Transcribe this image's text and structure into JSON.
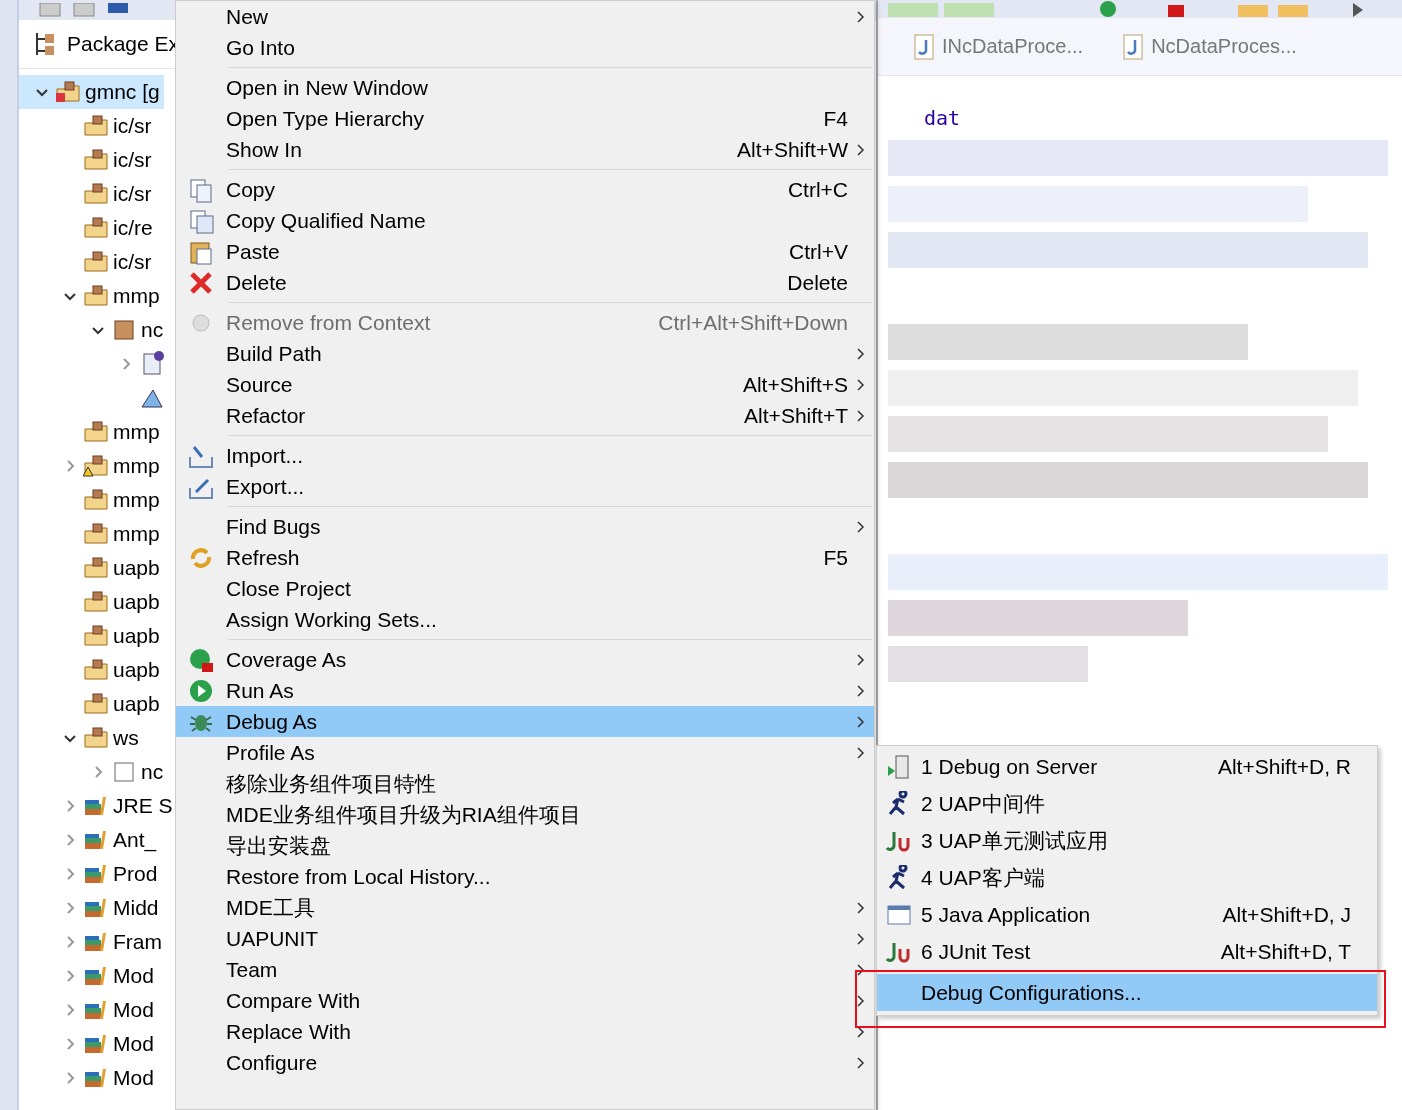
{
  "explorer": {
    "title": "Package Ex",
    "tree": [
      {
        "label": "gmnc [g",
        "kind": "project",
        "expanded": true,
        "selected": true,
        "children": [
          {
            "label": "ic/sr",
            "kind": "package-folder",
            "selected": false
          },
          {
            "label": "ic/sr",
            "kind": "package-folder",
            "selected": false
          },
          {
            "label": "ic/sr",
            "kind": "package-folder",
            "selected": false
          },
          {
            "label": "ic/re",
            "kind": "package-folder",
            "selected": false
          },
          {
            "label": "ic/sr",
            "kind": "package-folder",
            "selected": false
          },
          {
            "label": "mmp",
            "kind": "package-folder",
            "expanded": true,
            "selected": false,
            "children": [
              {
                "label": "nc",
                "kind": "package",
                "expanded": true,
                "selected": false,
                "children": [
                  {
                    "kind": "interface-file",
                    "expanded": false,
                    "selected": false
                  },
                  {
                    "kind": "diagram-file",
                    "selected": false
                  }
                ]
              }
            ]
          },
          {
            "label": "mmp",
            "kind": "package-folder",
            "selected": false
          },
          {
            "label": "mmp",
            "kind": "warning-folder",
            "expanded": false,
            "selected": false
          },
          {
            "label": "mmp",
            "kind": "package-folder",
            "selected": false
          },
          {
            "label": "mmp",
            "kind": "package-folder",
            "selected": false
          },
          {
            "label": "uapb",
            "kind": "package-folder",
            "selected": false
          },
          {
            "label": "uapb",
            "kind": "package-folder",
            "selected": false
          },
          {
            "label": "uapb",
            "kind": "package-folder",
            "selected": false
          },
          {
            "label": "uapb",
            "kind": "package-folder",
            "selected": false
          },
          {
            "label": "uapb",
            "kind": "package-folder",
            "selected": false
          },
          {
            "label": "ws",
            "kind": "package-folder",
            "expanded": true,
            "selected": false,
            "children": [
              {
                "label": "nc",
                "kind": "empty-package",
                "expanded": false,
                "selected": false
              }
            ]
          },
          {
            "label": "JRE S",
            "kind": "library",
            "expanded": false,
            "selected": false
          },
          {
            "label": "Ant_",
            "kind": "library",
            "expanded": false,
            "selected": false
          },
          {
            "label": "Prod",
            "kind": "library",
            "expanded": false,
            "selected": false
          },
          {
            "label": "Midd",
            "kind": "library",
            "expanded": false,
            "selected": false
          },
          {
            "label": "Fram",
            "kind": "library",
            "expanded": false,
            "selected": false
          },
          {
            "label": "Mod",
            "kind": "library",
            "expanded": false,
            "selected": false
          },
          {
            "label": "Mod",
            "kind": "library",
            "expanded": false,
            "selected": false
          },
          {
            "label": "Mod",
            "kind": "library",
            "expanded": false,
            "selected": false
          },
          {
            "label": "Mod",
            "kind": "library",
            "expanded": false,
            "selected": false
          }
        ]
      }
    ]
  },
  "editor": {
    "tabs": [
      {
        "label": "INcDataProce...",
        "selected": false
      },
      {
        "label": "NcDataProces...",
        "selected": false
      }
    ],
    "code_fragment": "dat"
  },
  "context_menu": [
    {
      "kind": "plain",
      "label": "New",
      "has_submenu": true,
      "disabled": false,
      "selected": false
    },
    {
      "kind": "plain",
      "label": "Go Into",
      "has_submenu": false,
      "disabled": false,
      "selected": false
    },
    {
      "kind": "separator"
    },
    {
      "kind": "plain",
      "label": "Open in New Window",
      "has_submenu": false,
      "disabled": false,
      "selected": false
    },
    {
      "kind": "plain",
      "label": "Open Type Hierarchy",
      "shortcut": "F4",
      "has_submenu": false,
      "disabled": false,
      "selected": false
    },
    {
      "kind": "plain",
      "label": "Show In",
      "shortcut": "Alt+Shift+W",
      "has_submenu": true,
      "disabled": false,
      "selected": false
    },
    {
      "kind": "separator"
    },
    {
      "kind": "copy",
      "label": "Copy",
      "shortcut": "Ctrl+C",
      "has_submenu": false,
      "disabled": false,
      "selected": false
    },
    {
      "kind": "copy-qualified",
      "label": "Copy Qualified Name",
      "has_submenu": false,
      "disabled": false,
      "selected": false
    },
    {
      "kind": "paste",
      "label": "Paste",
      "shortcut": "Ctrl+V",
      "has_submenu": false,
      "disabled": false,
      "selected": false
    },
    {
      "kind": "delete",
      "label": "Delete",
      "shortcut": "Delete",
      "has_submenu": false,
      "disabled": false,
      "selected": false
    },
    {
      "kind": "separator"
    },
    {
      "kind": "remove",
      "label": "Remove from Context",
      "shortcut": "Ctrl+Alt+Shift+Down",
      "has_submenu": false,
      "disabled": true,
      "selected": false
    },
    {
      "kind": "plain",
      "label": "Build Path",
      "has_submenu": true,
      "disabled": false,
      "selected": false
    },
    {
      "kind": "plain",
      "label": "Source",
      "shortcut": "Alt+Shift+S",
      "has_submenu": true,
      "disabled": false,
      "selected": false
    },
    {
      "kind": "plain",
      "label": "Refactor",
      "shortcut": "Alt+Shift+T",
      "has_submenu": true,
      "disabled": false,
      "selected": false
    },
    {
      "kind": "separator"
    },
    {
      "kind": "import",
      "label": "Import...",
      "has_submenu": false,
      "disabled": false,
      "selected": false
    },
    {
      "kind": "export",
      "label": "Export...",
      "has_submenu": false,
      "disabled": false,
      "selected": false
    },
    {
      "kind": "separator"
    },
    {
      "kind": "plain",
      "label": "Find Bugs",
      "has_submenu": true,
      "disabled": false,
      "selected": false
    },
    {
      "kind": "refresh",
      "label": "Refresh",
      "shortcut": "F5",
      "has_submenu": false,
      "disabled": false,
      "selected": false
    },
    {
      "kind": "plain",
      "label": "Close Project",
      "has_submenu": false,
      "disabled": false,
      "selected": false
    },
    {
      "kind": "plain",
      "label": "Assign Working Sets...",
      "has_submenu": false,
      "disabled": false,
      "selected": false
    },
    {
      "kind": "separator"
    },
    {
      "kind": "coverage",
      "label": "Coverage As",
      "has_submenu": true,
      "disabled": false,
      "selected": false
    },
    {
      "kind": "run",
      "label": "Run As",
      "has_submenu": true,
      "disabled": false,
      "selected": false
    },
    {
      "kind": "debug",
      "label": "Debug As",
      "has_submenu": true,
      "disabled": false,
      "selected": true
    },
    {
      "kind": "plain",
      "label": "Profile As",
      "has_submenu": true,
      "disabled": false,
      "selected": false
    },
    {
      "kind": "plain",
      "label": "移除业务组件项目特性",
      "has_submenu": false,
      "disabled": false,
      "selected": false
    },
    {
      "kind": "plain",
      "label": "MDE业务组件项目升级为RIA组件项目",
      "has_submenu": false,
      "disabled": false,
      "selected": false
    },
    {
      "kind": "plain",
      "label": "导出安装盘",
      "has_submenu": false,
      "disabled": false,
      "selected": false
    },
    {
      "kind": "plain",
      "label": "Restore from Local History...",
      "has_submenu": false,
      "disabled": false,
      "selected": false
    },
    {
      "kind": "plain",
      "label": "MDE工具",
      "has_submenu": true,
      "disabled": false,
      "selected": false
    },
    {
      "kind": "plain",
      "label": "UAPUNIT",
      "has_submenu": true,
      "disabled": false,
      "selected": false
    },
    {
      "kind": "plain",
      "label": "Team",
      "has_submenu": true,
      "disabled": false,
      "selected": false
    },
    {
      "kind": "plain",
      "label": "Compare With",
      "has_submenu": true,
      "disabled": false,
      "selected": false
    },
    {
      "kind": "plain",
      "label": "Replace With",
      "has_submenu": true,
      "disabled": false,
      "selected": false
    },
    {
      "kind": "plain",
      "label": "Configure",
      "has_submenu": true,
      "disabled": false,
      "selected": false
    }
  ],
  "debug_submenu": [
    {
      "kind": "server",
      "label": "1 Debug on Server",
      "shortcut": "Alt+Shift+D, R",
      "selected": false,
      "annotated": false
    },
    {
      "kind": "runner",
      "label": "2 UAP中间件",
      "selected": false,
      "annotated": false
    },
    {
      "kind": "junit",
      "label": "3 UAP单元测试应用",
      "selected": false,
      "annotated": false
    },
    {
      "kind": "runner",
      "label": "4 UAP客户端",
      "selected": false,
      "annotated": false
    },
    {
      "kind": "java-app",
      "label": "5 Java Application",
      "shortcut": "Alt+Shift+D, J",
      "selected": false,
      "annotated": false
    },
    {
      "kind": "junit",
      "label": "6 JUnit Test",
      "shortcut": "Alt+Shift+D, T",
      "selected": false,
      "annotated": false
    },
    {
      "kind": "separator"
    },
    {
      "kind": "plain",
      "label": "Debug Configurations...",
      "selected": true,
      "annotated": true
    }
  ]
}
